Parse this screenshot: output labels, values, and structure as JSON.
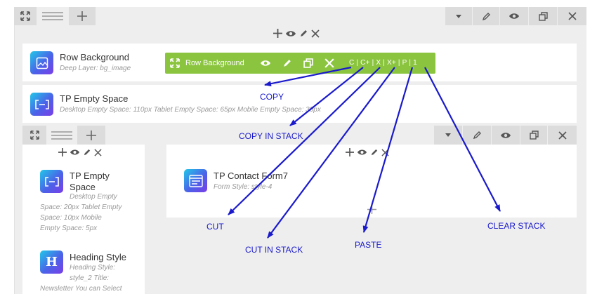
{
  "row_background": {
    "title": "Row Background",
    "desc": "Deep Layer: bg_image"
  },
  "empty_space_1": {
    "title": "TP Empty Space",
    "desc": "Desktop Empty Space: 110px  Tablet Empty Space: 65px  Mobile Empty Space: 30px"
  },
  "toolbar": {
    "title": "Row Background",
    "codes": "C | C+ | X | X+ | P | 1"
  },
  "left_column": {
    "empty_space": {
      "title_line1": "TP Empty",
      "title_line2": "Space",
      "desc_lines": [
        "Desktop Empty",
        "Space: 20px  Tablet Empty",
        "Space: 10px  Mobile",
        "Empty Space: 5px"
      ]
    },
    "heading": {
      "title": "Heading Style",
      "icon_letter": "H",
      "desc_lines": [
        "Heading Style:",
        "style_2  Title:",
        "Newsletter  You can Select"
      ]
    }
  },
  "right_column": {
    "contact_form": {
      "title": "TP Contact Form7",
      "desc": "Form Style: style-4"
    }
  },
  "annotations": {
    "copy": "COPY",
    "copy_in_stack": "COPY IN STACK",
    "cut": "CUT",
    "cut_in_stack": "CUT IN STACK",
    "paste": "PASTE",
    "clear_stack": "CLEAR STACK"
  },
  "colors": {
    "toolbar_green": "#8bc53f",
    "annotation_blue": "#1a1acc",
    "icon_gradient_start": "#21c8e8",
    "icon_gradient_end": "#7a3ee8"
  }
}
